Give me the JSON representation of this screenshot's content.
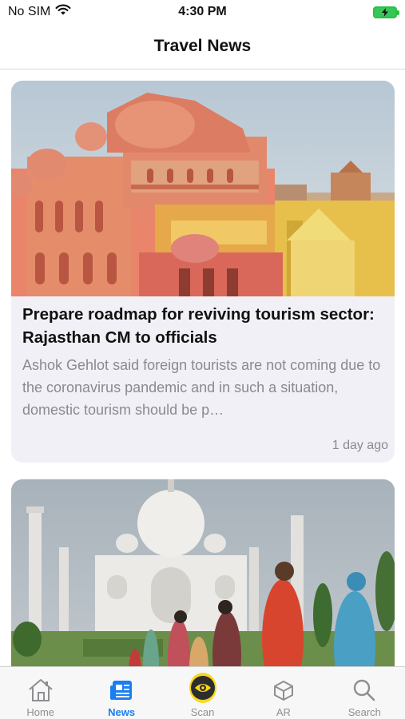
{
  "status_bar": {
    "carrier": "No SIM",
    "time": "4:30 PM"
  },
  "header": {
    "title": "Travel News"
  },
  "articles": [
    {
      "title": "Prepare roadmap for reviving tourism sector: Rajasthan CM to officials",
      "summary": "Ashok Gehlot said foreign tourists are not coming due to the coronavirus pandemic and in such a situation, domestic tourism should be p…",
      "time": "1 day ago",
      "image": "hawa-mahal-photo"
    },
    {
      "image": "taj-mahal-photo"
    }
  ],
  "tab_bar": {
    "tabs": [
      {
        "label": "Home",
        "icon": "home-icon",
        "active": false
      },
      {
        "label": "News",
        "icon": "news-icon",
        "active": true
      },
      {
        "label": "Scan",
        "icon": "scan-eye-icon",
        "active": false
      },
      {
        "label": "AR",
        "icon": "cube-icon",
        "active": false
      },
      {
        "label": "Search",
        "icon": "search-icon",
        "active": false
      }
    ]
  },
  "colors": {
    "accent": "#1a7ef0",
    "inactive_tab": "#8e8e93",
    "card_background": "#f1f0f6",
    "battery": "#35c759",
    "scan_button": "#f7d81f"
  }
}
